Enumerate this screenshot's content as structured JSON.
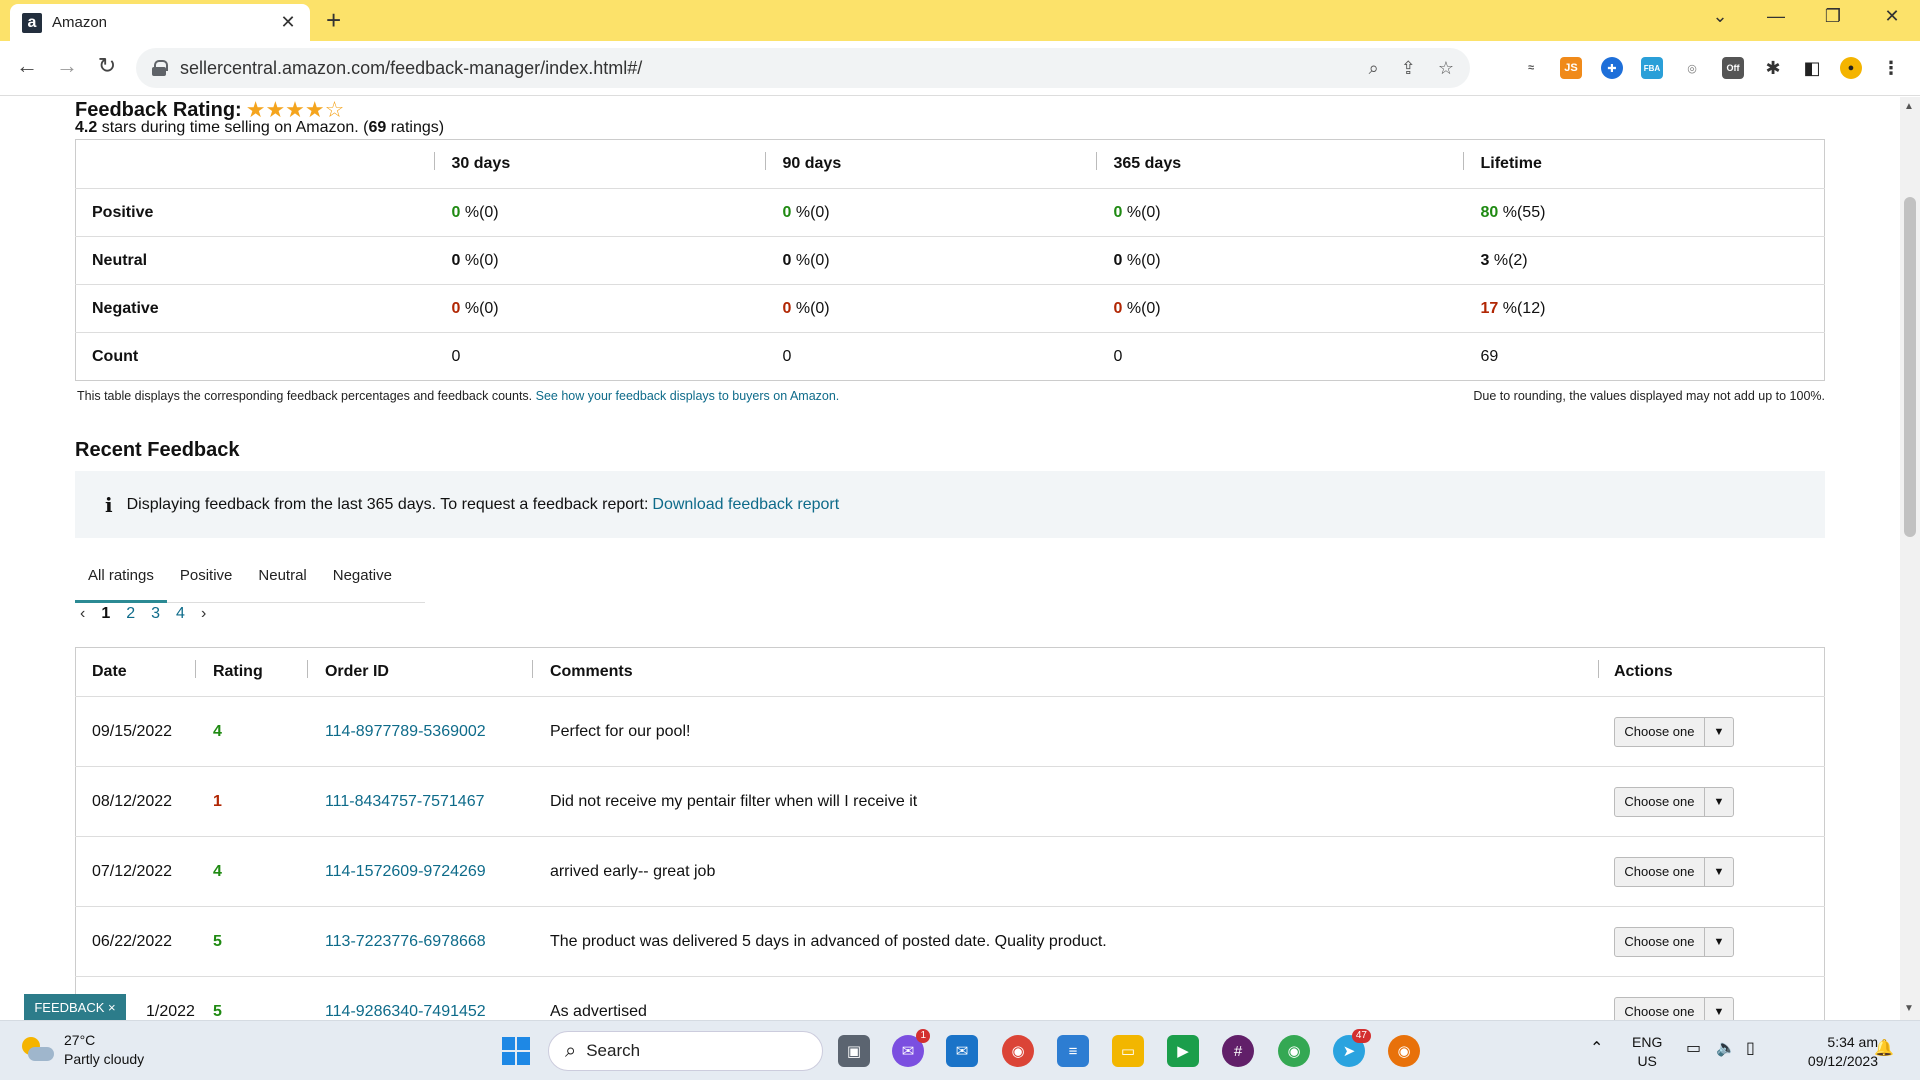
{
  "browser": {
    "tab_title": "Amazon",
    "favicon": "a",
    "url": "sellercentral.amazon.com/feedback-manager/index.html#/"
  },
  "rating": {
    "title": "Feedback Rating:",
    "stars": 4.2,
    "score": "4.2",
    "sub_middle": " stars during time selling on Amazon. (",
    "count": "69",
    "sub_end": " ratings)"
  },
  "summary": {
    "headers": [
      "30 days",
      "90 days",
      "365 days",
      "Lifetime"
    ],
    "rows": [
      {
        "label": "Positive",
        "cells": [
          {
            "pct": "0",
            "rest": " %(0)"
          },
          {
            "pct": "0",
            "rest": " %(0)"
          },
          {
            "pct": "0",
            "rest": " %(0)"
          },
          {
            "pct": "80",
            "rest": " %(55)"
          }
        ]
      },
      {
        "label": "Neutral",
        "cells": [
          {
            "pct": "0",
            "rest": " %(0)"
          },
          {
            "pct": "0",
            "rest": " %(0)"
          },
          {
            "pct": "0",
            "rest": " %(0)"
          },
          {
            "pct": "3",
            "rest": " %(2)"
          }
        ]
      },
      {
        "label": "Negative",
        "cells": [
          {
            "pct": "0",
            "rest": " %(0)"
          },
          {
            "pct": "0",
            "rest": " %(0)"
          },
          {
            "pct": "0",
            "rest": " %(0)"
          },
          {
            "pct": "17",
            "rest": " %(12)"
          }
        ]
      },
      {
        "label": "Count",
        "cells": [
          "0",
          "0",
          "0",
          "69"
        ]
      }
    ],
    "note_left": "This table displays the corresponding feedback percentages and feedback counts. ",
    "note_link": "See how your feedback displays to buyers on Amazon.",
    "note_right": "Due to rounding, the values displayed may not add up to 100%."
  },
  "recent": {
    "title": "Recent Feedback",
    "info_text": "Displaying feedback from the last 365 days. To request a feedback report: ",
    "info_link": "Download feedback report",
    "tabs": [
      "All ratings",
      "Positive",
      "Neutral",
      "Negative"
    ],
    "pages": [
      "1",
      "2",
      "3",
      "4"
    ],
    "columns": [
      "Date",
      "Rating",
      "Order ID",
      "Comments",
      "Actions"
    ],
    "rows": [
      {
        "date": "09/15/2022",
        "rating": "4",
        "order": "114-8977789-5369002",
        "comment": "Perfect for our pool!",
        "action": "Choose one"
      },
      {
        "date": "08/12/2022",
        "rating": "1",
        "order": "111-8434757-7571467",
        "comment": "Did not receive my pentair filter when will I receive it",
        "action": "Choose one"
      },
      {
        "date": "07/12/2022",
        "rating": "4",
        "order": "114-1572609-9724269",
        "comment": "arrived early-- great job",
        "action": "Choose one"
      },
      {
        "date": "06/22/2022",
        "rating": "5",
        "order": "113-7223776-6978668",
        "comment": "The product was delivered 5 days in advanced of posted date. Quality product.",
        "action": "Choose one"
      },
      {
        "date": "1/2022",
        "rating": "5",
        "order": "114-9286340-7491452",
        "comment": "As advertised",
        "action": "Choose one"
      }
    ],
    "feedback_tag": "FEEDBACK"
  },
  "colors": {
    "positive": "#1f8a12",
    "negative": "#b12704",
    "link": "#0e6b8a",
    "tabstrip": "#fce26a"
  },
  "taskbar": {
    "temp": "27°C",
    "weather": "Partly cloudy",
    "search": "Search",
    "lang1": "ENG",
    "lang2": "US",
    "time": "5:34 am",
    "date": "09/12/2023",
    "messenger_badge": "1",
    "telegram_badge": "47"
  }
}
